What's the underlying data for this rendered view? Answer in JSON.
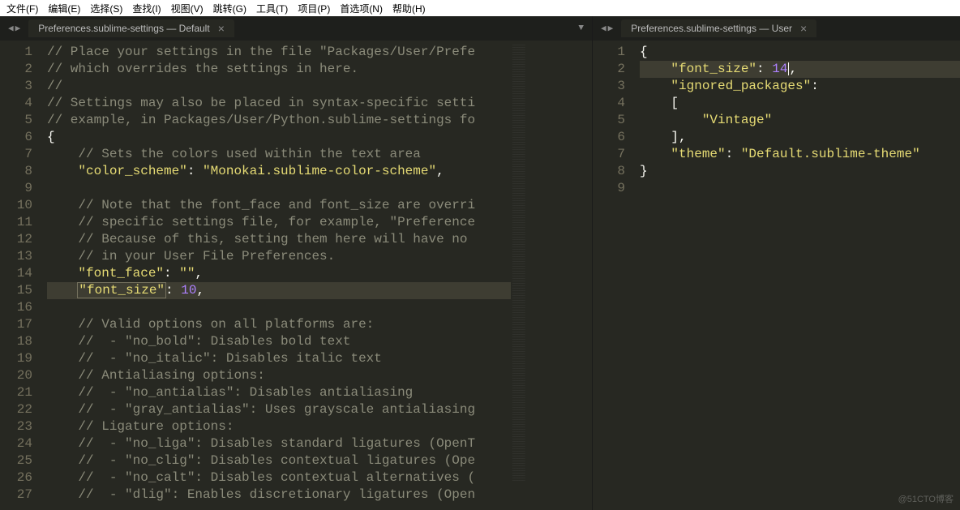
{
  "menu": [
    "文件(F)",
    "编辑(E)",
    "选择(S)",
    "查找(I)",
    "视图(V)",
    "跳转(G)",
    "工具(T)",
    "项目(P)",
    "首选项(N)",
    "帮助(H)"
  ],
  "left": {
    "tab": "Preferences.sublime-settings — Default",
    "lines": [
      {
        "n": 1,
        "t": "comment",
        "txt": "// Place your settings in the file \"Packages/User/Prefe"
      },
      {
        "n": 2,
        "t": "comment",
        "txt": "// which overrides the settings in here."
      },
      {
        "n": 3,
        "t": "comment",
        "txt": "//"
      },
      {
        "n": 4,
        "t": "comment",
        "txt": "// Settings may also be placed in syntax-specific setti"
      },
      {
        "n": 5,
        "t": "comment",
        "txt": "// example, in Packages/User/Python.sublime-settings fo"
      },
      {
        "n": 6,
        "t": "brace",
        "txt": "{"
      },
      {
        "n": 7,
        "t": "icomment",
        "txt": "// Sets the colors used within the text area"
      },
      {
        "n": 8,
        "t": "kv",
        "key": "\"color_scheme\"",
        "val": "\"Monokai.sublime-color-scheme\"",
        "vtype": "str",
        "comma": true
      },
      {
        "n": 9,
        "t": "blank",
        "txt": ""
      },
      {
        "n": 10,
        "t": "icomment",
        "txt": "// Note that the font_face and font_size are overri"
      },
      {
        "n": 11,
        "t": "icomment",
        "txt": "// specific settings file, for example, \"Preference"
      },
      {
        "n": 12,
        "t": "icomment",
        "txt": "// Because of this, setting them here will have no "
      },
      {
        "n": 13,
        "t": "icomment",
        "txt": "// in your User File Preferences."
      },
      {
        "n": 14,
        "t": "kv",
        "key": "\"font_face\"",
        "val": "\"\"",
        "vtype": "str",
        "comma": true
      },
      {
        "n": 15,
        "t": "kv",
        "key": "\"font_size\"",
        "val": "10",
        "vtype": "num",
        "comma": true,
        "hl": true,
        "box": true
      },
      {
        "n": 16,
        "t": "blank",
        "txt": ""
      },
      {
        "n": 17,
        "t": "icomment",
        "txt": "// Valid options on all platforms are:"
      },
      {
        "n": 18,
        "t": "icomment",
        "txt": "//  - \"no_bold\": Disables bold text"
      },
      {
        "n": 19,
        "t": "icomment",
        "txt": "//  - \"no_italic\": Disables italic text"
      },
      {
        "n": 20,
        "t": "icomment",
        "txt": "// Antialiasing options:"
      },
      {
        "n": 21,
        "t": "icomment",
        "txt": "//  - \"no_antialias\": Disables antialiasing"
      },
      {
        "n": 22,
        "t": "icomment",
        "txt": "//  - \"gray_antialias\": Uses grayscale antialiasing"
      },
      {
        "n": 23,
        "t": "icomment",
        "txt": "// Ligature options:"
      },
      {
        "n": 24,
        "t": "icomment",
        "txt": "//  - \"no_liga\": Disables standard ligatures (OpenT"
      },
      {
        "n": 25,
        "t": "icomment",
        "txt": "//  - \"no_clig\": Disables contextual ligatures (Ope"
      },
      {
        "n": 26,
        "t": "icomment",
        "txt": "//  - \"no_calt\": Disables contextual alternatives ("
      },
      {
        "n": 27,
        "t": "icomment",
        "txt": "//  - \"dlig\": Enables discretionary ligatures (Open"
      }
    ]
  },
  "right": {
    "tab": "Preferences.sublime-settings — User",
    "lines": [
      {
        "n": 1,
        "t": "brace",
        "txt": "{"
      },
      {
        "n": 2,
        "t": "kv",
        "key": "\"font_size\"",
        "val": "14",
        "vtype": "num",
        "comma": true,
        "hl": true,
        "cursor": true
      },
      {
        "n": 3,
        "t": "kvonly",
        "key": "\"ignored_packages\"",
        "colon": true
      },
      {
        "n": 4,
        "t": "raw",
        "txt": "    [",
        "cls": "c-punct"
      },
      {
        "n": 5,
        "t": "raw",
        "txt": "        \"Vintage\"",
        "cls": "c-str"
      },
      {
        "n": 6,
        "t": "raw",
        "txt": "    ],",
        "cls": "c-punct"
      },
      {
        "n": 7,
        "t": "kv",
        "key": "\"theme\"",
        "val": "\"Default.sublime-theme\"",
        "vtype": "str",
        "comma": false
      },
      {
        "n": 8,
        "t": "brace",
        "txt": "}"
      },
      {
        "n": 9,
        "t": "blank",
        "txt": ""
      }
    ]
  },
  "watermark": "@51CTO博客"
}
